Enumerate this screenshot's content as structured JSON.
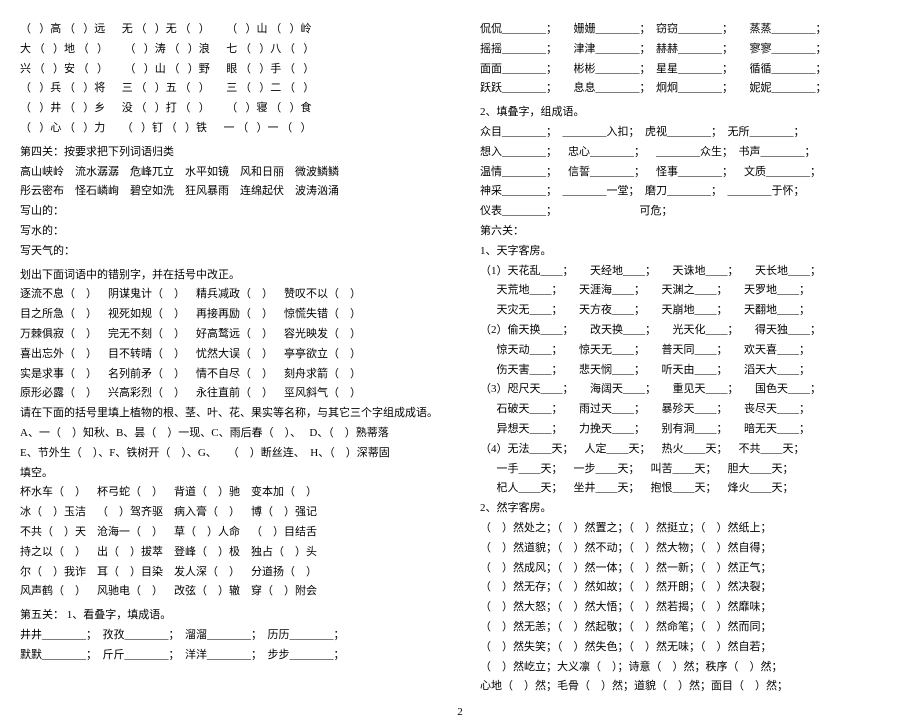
{
  "left": {
    "fill_patterns": [
      "（   ）高 （   ）远      无 （   ）无 （   ）      （   ）山 （   ）岭",
      "大 （   ）地 （   ）      （   ）涛 （   ）浪      七 （   ）八 （   ）",
      "兴 （   ）安 （   ）      （   ）山 （   ）野      眼 （   ）手 （   ）",
      "（   ）兵 （   ）将      三 （   ）五 （   ）      三 （   ）二 （   ）",
      "（   ）井 （   ）乡      没 （   ）打 （   ）      （   ）寝 （   ）食",
      "（   ）心 （   ）力      （   ）钉 （   ）铁      一 （   ）一 （   ）"
    ],
    "section4_title": "第四关：按要求把下列词语归类",
    "section4_words": [
      "高山峡岭    流水潺潺    危峰兀立    水平如镜    风和日丽    微波鳞鳞",
      "彤云密布    怪石嶙峋    碧空如洗    狂风暴雨    连绵起伏    波涛汹涌"
    ],
    "section4_prompts": [
      "写山的：",
      "写水的：",
      "写天气的："
    ],
    "errors_title": "划出下面词语中的错别字，并在括号中改正。",
    "errors_rows": [
      "逐流不息（    ）    阴谋鬼计（    ）    精兵减政（    ）    赞叹不以（    ）",
      "目之所急（    ）    视死如规（    ）    再接再励（    ）    惊慌失错（    ）",
      "万棘俱寂（    ）    完无不刻（    ）    好高鹜远（    ）    容光映发（    ）",
      "喜出忘外（    ）    目不转晴（    ）    忧然大误（    ）    亭亭欲立（    ）",
      "实是求事（    ）    名列前矛（    ）    情不自尽（    ）    刻舟求箭（    ）",
      "原形必露（    ）    兴高彩烈（    ）    永往直前（    ）    巠风斜气（    ）"
    ],
    "plants_title": "请在下面的括号里填上植物的根、茎、叶、花、果实等名称，与其它三个字组成成语。",
    "plants_rows": [
      "A、一（    ）知秋、B、昙（    ）一现、C、雨后春（    ）、   D、（    ）熟蒂落",
      "E、节外生（    ）、F、铁树开（    ）、G、    （    ）断丝连、  H、（    ）深蒂固",
      "填空。"
    ],
    "fill_rows": [
      "杯水车（    ）    杯弓蛇（    ）    背道（    ）驰    变本加（    ）",
      "冰（    ）玉洁    （    ）驾齐驱    病入膏（    ）    博（    ）强记",
      "不共（    ）天    沧海一（    ）    草（    ）人命    （    ）目结舌",
      "持之以（    ）    出（    ）拔萃    登峰（    ）极    独占（    ）头",
      "尔（    ）我诈    耳（    ）目染    发人深（    ）    分道扬（    ）",
      "风声鹤（    ）    风驰电（    ）    改弦（    ）辙    穿（    ）附会"
    ],
    "section5_title": "第五关：  1、看叠字，填成语。",
    "redup_rows": [
      "井井________；  孜孜________；  溜溜________；  历历________；",
      "默默________；  斤斤________；  洋洋________；  步步________；"
    ]
  },
  "right": {
    "redup_rows": [
      "侃侃________；      姗姗________；  窃窃________；      蒸蒸________；",
      "摇摇________；      津津________；  赫赫________；      寥寥________；",
      "面面________；      彬彬________；  星星________；      循循________；",
      "跃跃________；      息息________；  炯炯________；      妮妮________；"
    ],
    "section2_title": "2、填叠字，组成语。",
    "redup2_rows": [
      "众目________；  ________入扣；  虎视________；  无所________；",
      "想入________；    忠心________；    ________众生；  书声________；",
      "温情________；    信誓________；    怪事________；    文质________；",
      "神采________；  ________一堂；  磨刀________；  ________于怀；",
      "仪表________；                              可危；"
    ],
    "section6_title": "第六关：",
    "sub1_title": "1、天字客房。",
    "tian_rows": [
      "（1）天花乱____；      天经地____；      天诛地____；      天长地____；",
      "      天荒地____；      天涯海____；      天渊之____；      天罗地____；",
      "      天灾无____；      天方夜____；      天崩地____；      天翻地____；",
      "（2）偷天换____；      改天换____；      光天化____；      得天独____；",
      "      惊天动____；      惊天无____；      普天同____；      欢天喜____；",
      "      伤天害____；      悲天悯____；      听天由____；      滔天大____；",
      "（3）咫尺天____；      海阔天____；      重见天____；      国色天____；",
      "      石破天____；      雨过天____；      暴殄天____；      丧尽天____；",
      "      异想天____；      力挽天____；      别有洞____；      暗无天____；",
      "（4）无法____天；    人定____天；    热火____天；    不共____天；",
      "      一手____天；    一步____天；    叫苦____天；    胆大____天；",
      "      杞人____天；    坐井____天；    抱恨____天；    烽火____天；"
    ],
    "sub2_title": "2、然字客房。",
    "ran_rows": [
      "（    ）然处之；（    ）然置之；（    ）然挺立；（    ）然纸上；",
      "（    ）然道貌；（    ）然不动；（    ）然大物；（    ）然自得；",
      "（    ）然成风；（    ）然一体；（    ）然一新；（    ）然正气；",
      "（    ）然无存；（    ）然如故；（    ）然开朗；（    ）然决裂；",
      "（    ）然大怒；（    ）然大悟；（    ）然若揭；（    ）然靡味；",
      "（    ）然无恙；（    ）然起敬；（    ）然命笔；（    ）然而同；",
      "（    ）然失笑；（    ）然失色；（    ）然无味；（    ）然自若；",
      "（    ）然屹立；大义凛（    ）；诗意（    ）然；秩序（    ）然；",
      "心地（    ）然；毛骨（    ）然；道貌（    ）然；面目（    ）然；"
    ]
  },
  "page_number": "2"
}
